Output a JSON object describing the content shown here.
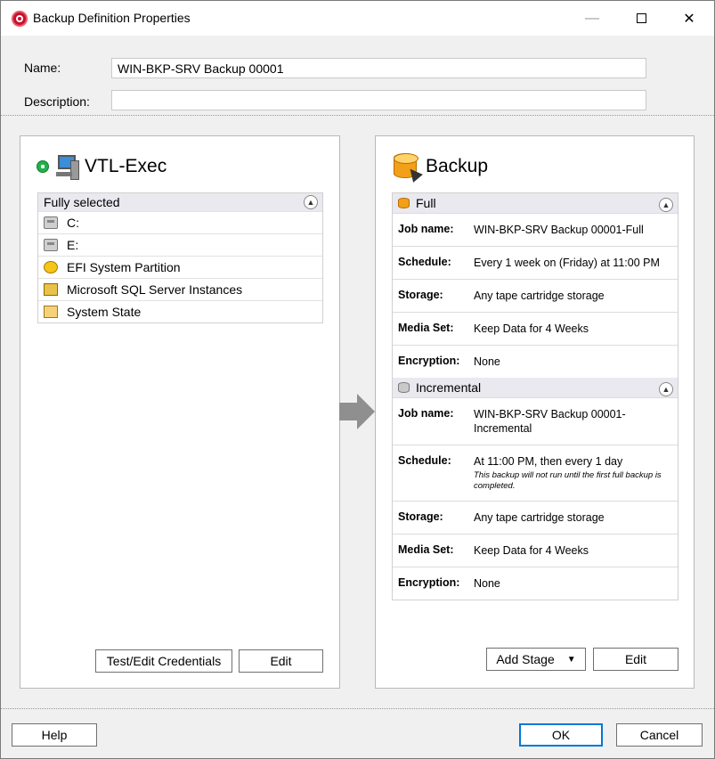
{
  "window": {
    "title": "Backup Definition Properties",
    "minimize_glyph": "—",
    "close_glyph": "✕"
  },
  "fields": {
    "name_label": "Name:",
    "name_value": "WIN-BKP-SRV Backup 00001",
    "description_label": "Description:",
    "description_value": ""
  },
  "source": {
    "title": "VTL-Exec",
    "selection_header": "Fully selected",
    "items": [
      {
        "label": "C:",
        "icon": "drive-icon"
      },
      {
        "label": "E:",
        "icon": "drive-icon"
      },
      {
        "label": "EFI System Partition",
        "icon": "efi-icon"
      },
      {
        "label": "Microsoft SQL Server Instances",
        "icon": "sql-server-icon"
      },
      {
        "label": "System State",
        "icon": "system-state-icon"
      }
    ],
    "test_credentials_label": "Test/Edit Credentials",
    "edit_label": "Edit"
  },
  "backup": {
    "title": "Backup",
    "stages": [
      {
        "name": "Full",
        "job_name_label": "Job name:",
        "job_name": "WIN-BKP-SRV Backup 00001-Full",
        "schedule_label": "Schedule:",
        "schedule": "Every 1 week on (Friday) at 11:00 PM",
        "storage_label": "Storage:",
        "storage": "Any tape cartridge storage",
        "media_set_label": "Media Set:",
        "media_set": "Keep Data for 4 Weeks",
        "encryption_label": "Encryption:",
        "encryption": "None"
      },
      {
        "name": "Incremental",
        "job_name_label": "Job name:",
        "job_name": "WIN-BKP-SRV Backup 00001-Incremental",
        "schedule_label": "Schedule:",
        "schedule": "At 11:00 PM, then every 1 day",
        "schedule_note": "This backup will not run until the first full backup is completed.",
        "storage_label": "Storage:",
        "storage": "Any tape cartridge storage",
        "media_set_label": "Media Set:",
        "media_set": "Keep Data for 4 Weeks",
        "encryption_label": "Encryption:",
        "encryption": "None"
      }
    ],
    "add_stage_label": "Add Stage",
    "edit_label": "Edit"
  },
  "footer": {
    "help_label": "Help",
    "ok_label": "OK",
    "cancel_label": "Cancel"
  },
  "colors": {
    "accent_blue": "#0078d7",
    "status_green": "#1fb34a",
    "brand_red": "#c8102e"
  }
}
